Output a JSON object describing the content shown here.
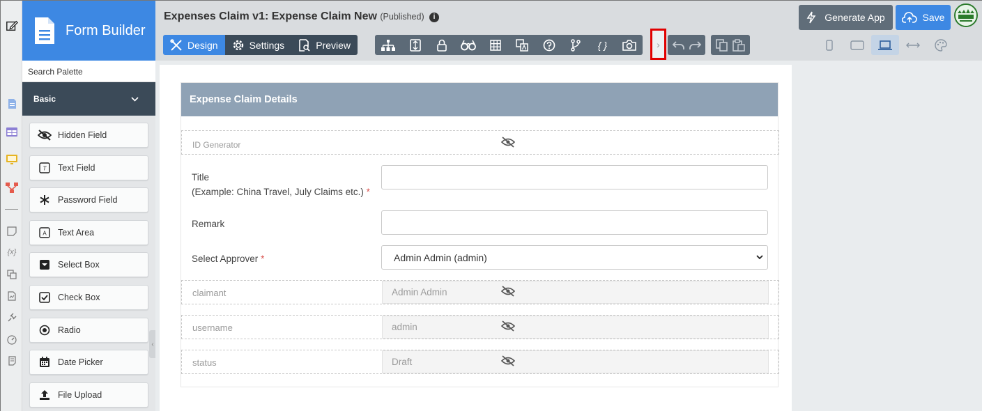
{
  "app": {
    "brand": "Form Builder",
    "search_placeholder": "Search Palette",
    "palette_section": "Basic",
    "palette_items": [
      "Hidden Field",
      "Text Field",
      "Password Field",
      "Text Area",
      "Select Box",
      "Check Box",
      "Radio",
      "Date Picker",
      "File Upload"
    ]
  },
  "header": {
    "title": "Expenses Claim v1: Expense Claim New",
    "status": "(Published)",
    "modes": [
      "Design",
      "Settings",
      "Preview"
    ],
    "active_mode": "Design",
    "toolbar_icons": [
      "tree-icon",
      "merge-icon",
      "lock-icon",
      "binoculars-icon",
      "grid-icon",
      "translate-icon",
      "help-icon",
      "branch-icon",
      "braces-icon",
      "camera-icon"
    ],
    "braces_text": "{ }",
    "more_glyph": "›",
    "generate_app": "Generate App",
    "save": "Save"
  },
  "form": {
    "section_title": "Expense Claim Details",
    "id_generator": "ID Generator",
    "title_label": "Title",
    "title_hint": "(Example: China Travel, July Claims etc.)",
    "required_mark": "*",
    "remark_label": "Remark",
    "approver_label": "Select Approver",
    "approver_value": "Admin Admin (admin)",
    "claimant_label": "claimant",
    "claimant_value": "Admin Admin",
    "username_label": "username",
    "username_value": "admin",
    "status_label": "status",
    "status_value": "Draft"
  },
  "colors": {
    "brand_blue": "#3d88e3",
    "dark_nav": "#3b4a58",
    "section_header": "#8fa2b5",
    "highlight_red": "#e10000"
  }
}
